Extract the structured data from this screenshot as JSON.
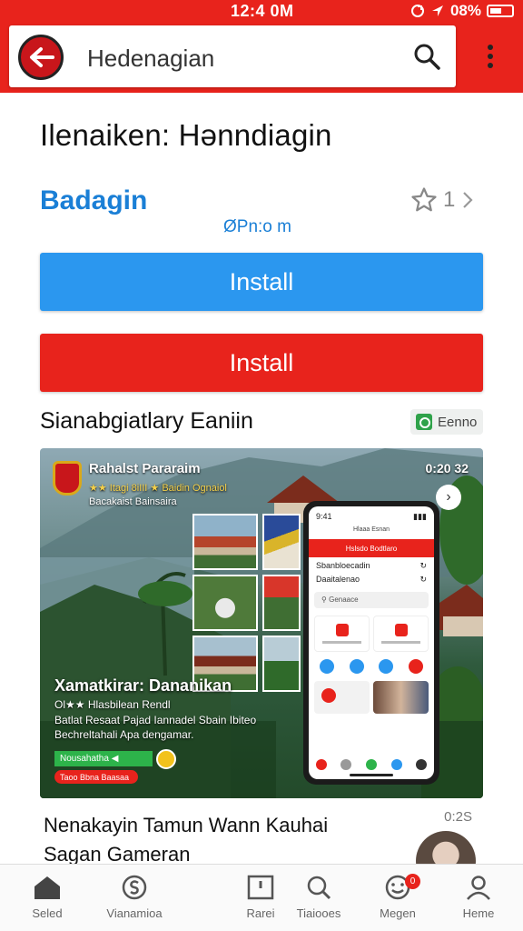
{
  "status_bar": {
    "time": "12:4 0M",
    "battery": "08%"
  },
  "header": {
    "search_text": "Hedenagian"
  },
  "page": {
    "title": "Ilenaiken: Hənndiagin",
    "app_name": "Badagin",
    "app_subtitle": "ØPn:o m",
    "rating": "1",
    "install_primary": "Install",
    "install_secondary": "Install",
    "section_title": "Sianabgiatlary Eaniin",
    "section_badge": "Eenno"
  },
  "banner": {
    "title": "Rahalst Pararaim",
    "subtitle1": "★★ Itagi 8iIII ★ Baidin Ognaiol",
    "subtitle2": "Bacakaist Bainsaira",
    "time": "0:20 32",
    "headline": "Xamatkirar: Dananikan",
    "line1": "Ol★★ Hlasbilean Rendl",
    "line2": "Batlat Resaat Pajad Iannadel Sbain Ibiteo",
    "line3": "Bechreltahali Apa dengamar.",
    "green_label": "Nousahatha ◀",
    "red_label": "Taoo Bbna Baasaa",
    "phone": {
      "status_time": "9:41",
      "subtitle": "Hlaaa Esnan",
      "bar_title": "Hslsdo Bodtlaro",
      "row1": "Sbanbloecadin",
      "row2": "Daaitalenao",
      "search": "Genaace"
    }
  },
  "list_item": {
    "title_line1": "Nenakayin Tamun Wann Kauhai",
    "title_line2": "Sagan Gameran",
    "time": "0:2S"
  },
  "bottom_nav": {
    "items": [
      {
        "label": "Seled",
        "icon": "home-icon"
      },
      {
        "label": "Vianamioa",
        "icon": "dollar-icon"
      },
      {
        "label": "Rarei",
        "icon": "card-icon"
      },
      {
        "label": "Tiaiooes",
        "icon": "search-icon"
      },
      {
        "label": "Megen",
        "icon": "smile-icon",
        "badge": "0"
      },
      {
        "label": "Heme",
        "icon": "person-icon"
      }
    ]
  },
  "colors": {
    "brand_red": "#e8231c",
    "install_blue": "#2b97ef",
    "link_blue": "#1a7fd6"
  }
}
